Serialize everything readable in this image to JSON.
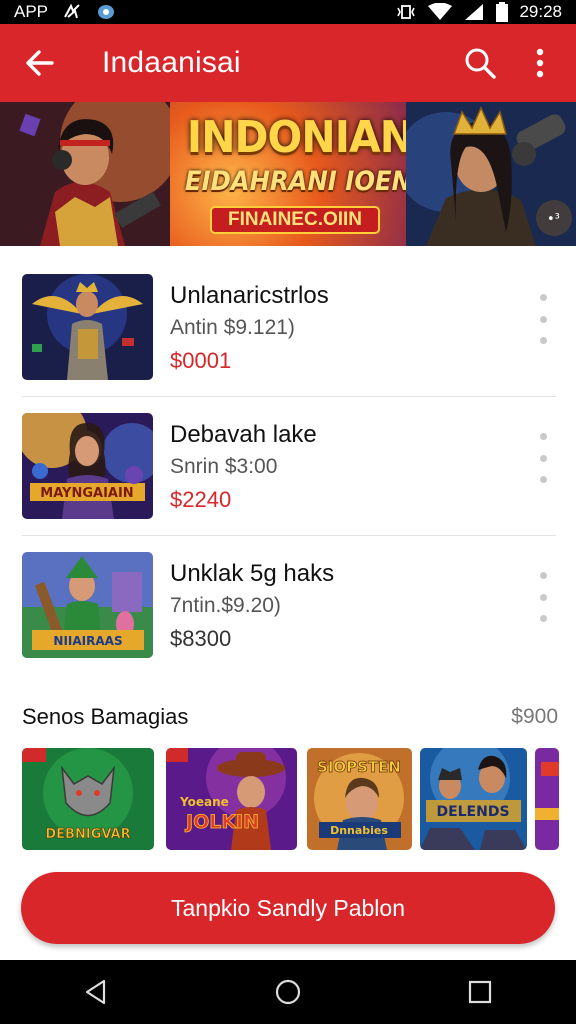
{
  "status_bar": {
    "app_label": "APP",
    "time": "29:28"
  },
  "app_bar": {
    "title": "Indaanisai",
    "icons": [
      "arrow-back-icon",
      "search-icon",
      "more-vert-icon"
    ]
  },
  "banner": {
    "title": "INDONIAN",
    "subtitle": "EIDAHRANI IOENIS",
    "pill": "FINAINEC.OIIN",
    "badge": "•³"
  },
  "items": [
    {
      "title": "Unlanaricstrlos",
      "subtitle": "Antin $9.121)",
      "price": "$0001",
      "price_style": "accent"
    },
    {
      "title": "Debavah lake",
      "subtitle": "Snrin $3:00",
      "price": "$2240",
      "price_style": "accent"
    },
    {
      "title": "Unklak 5g haks",
      "subtitle": "7ntin.$9.20)",
      "price": "$8300",
      "price_style": "muted"
    }
  ],
  "section": {
    "title": "Senos Bamagias",
    "count": "$900"
  },
  "carousel": [
    {
      "label": "DEBNIGVAR"
    },
    {
      "label": "JOLKIN"
    },
    {
      "label": "SIOPSTEN"
    },
    {
      "label": "DELENDS"
    }
  ],
  "cta": {
    "label": "Tanpkio Sandly Pablon"
  },
  "colors": {
    "accent": "#d8262a",
    "status_bar": "#000000",
    "divider": "#e3e3e3"
  }
}
